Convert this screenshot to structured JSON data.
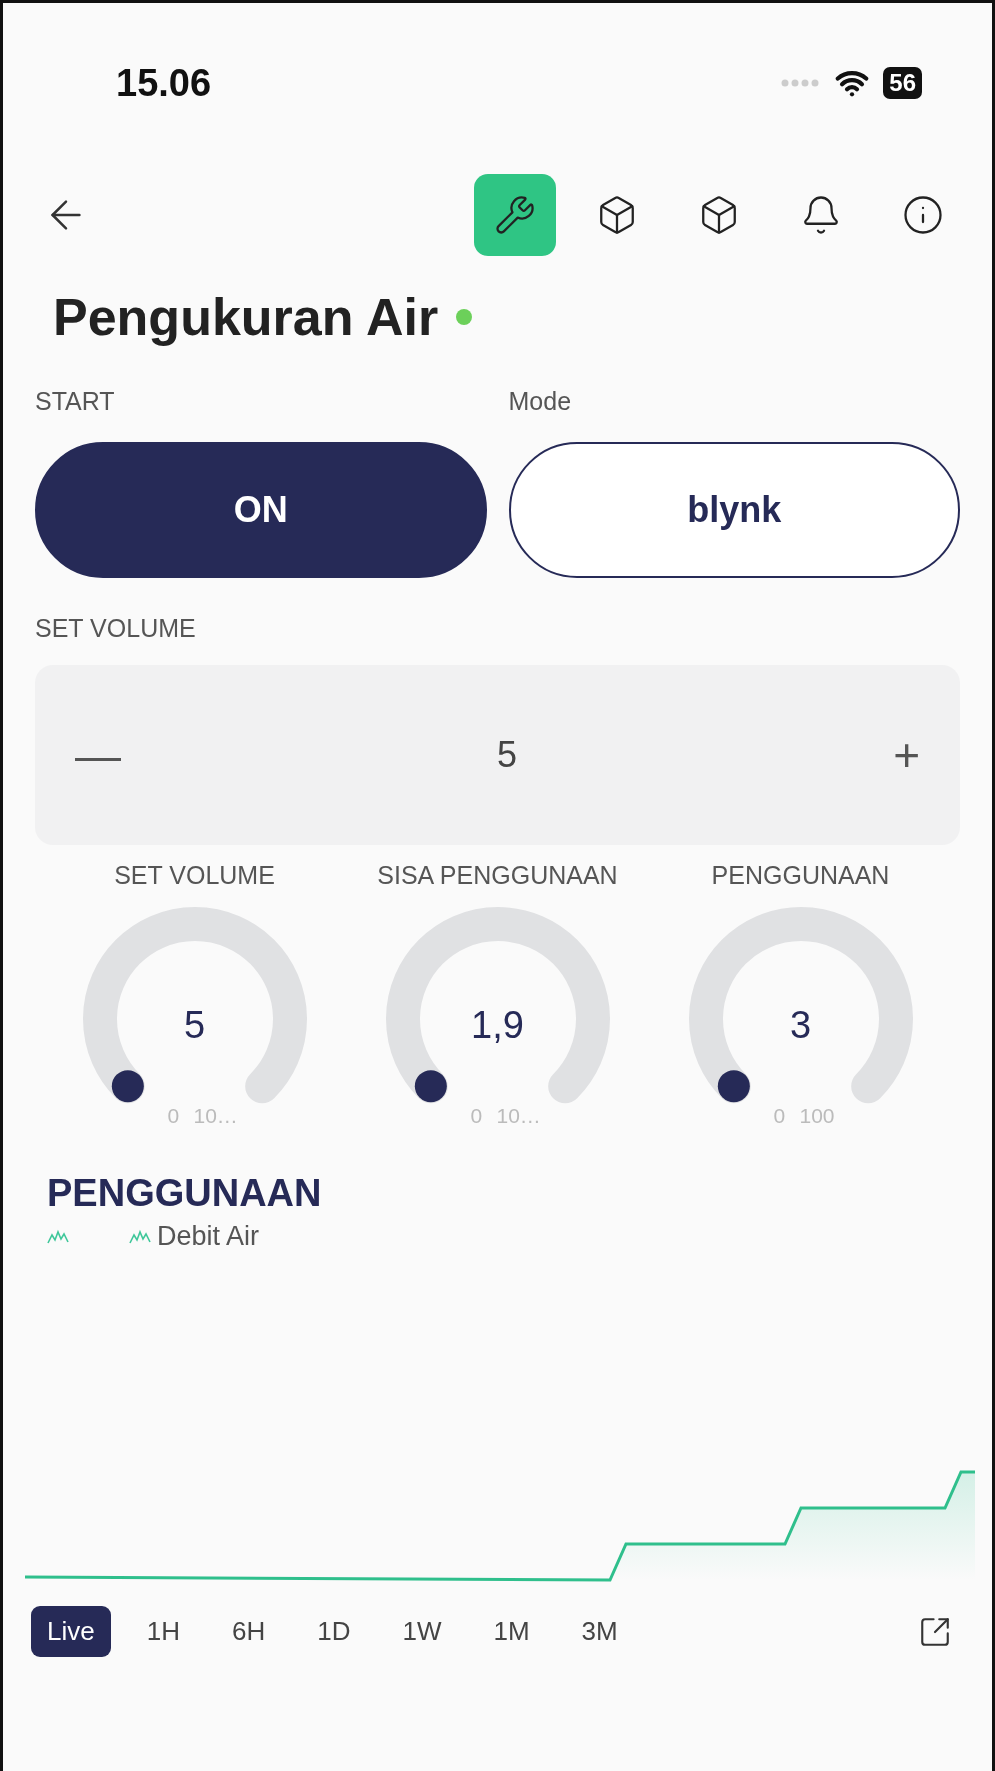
{
  "status_bar": {
    "time": "15.06",
    "battery": "56"
  },
  "header": {
    "tools": [
      {
        "kind": "wrench",
        "selected": true
      },
      {
        "kind": "box",
        "selected": false
      },
      {
        "kind": "box",
        "selected": false
      },
      {
        "kind": "bell",
        "selected": false
      },
      {
        "kind": "info",
        "selected": false
      }
    ]
  },
  "device": {
    "title": "Pengukuran Air",
    "online": true
  },
  "controls": [
    {
      "label": "START",
      "value": "ON",
      "on": true
    },
    {
      "label": "Mode",
      "value": "blynk",
      "on": false
    }
  ],
  "stepper": {
    "label": "SET VOLUME",
    "minus": "—",
    "value": "5",
    "plus": "+"
  },
  "gauges": [
    {
      "label": "SET VOLUME",
      "value": "5",
      "min": "0",
      "max": "10…"
    },
    {
      "label": "SISA PENGGUNAAN",
      "value": "1,9",
      "min": "0",
      "max": "10…"
    },
    {
      "label": "PENGGUNAAN",
      "value": "3",
      "min": "0",
      "max": "100"
    }
  ],
  "chart": {
    "title": "PENGGUNAAN",
    "legend": [
      {
        "kind": "line"
      },
      {
        "kind": "line",
        "label": "Debit Air"
      }
    ]
  },
  "ranges": [
    {
      "label": "Live",
      "selected": true
    },
    {
      "label": "1H",
      "selected": false
    },
    {
      "label": "6H",
      "selected": false
    },
    {
      "label": "1D",
      "selected": false
    },
    {
      "label": "1W",
      "selected": false
    },
    {
      "label": "1M",
      "selected": false
    },
    {
      "label": "3M",
      "selected": false
    }
  ]
}
